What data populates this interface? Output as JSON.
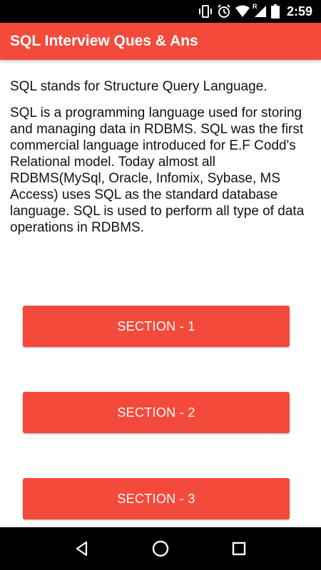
{
  "status_bar": {
    "time": "2:59",
    "icons": [
      "vibrate-icon",
      "alarm-icon",
      "wifi-icon",
      "signal-roaming-icon",
      "battery-icon"
    ],
    "roaming_label": "R"
  },
  "app_bar": {
    "title": "SQL Interview Ques & Ans",
    "color": "#f44a3c"
  },
  "content": {
    "paragraph_1": "SQL stands for Structure Query Language.",
    "paragraph_2": "SQL is a programming language used for storing and managing data in RDBMS. SQL was the first commercial language introduced for E.F Codd's Relational model. Today almost all RDBMS(MySql, Oracle, Infomix, Sybase, MS Access) uses SQL as the standard database language. SQL is used to perform all type of data operations in RDBMS."
  },
  "buttons": {
    "section_1": "SECTION - 1",
    "section_2": "SECTION - 2",
    "section_3": "SECTION - 3"
  },
  "nav_bar": {
    "icons": [
      "back-icon",
      "home-icon",
      "recents-icon"
    ]
  }
}
